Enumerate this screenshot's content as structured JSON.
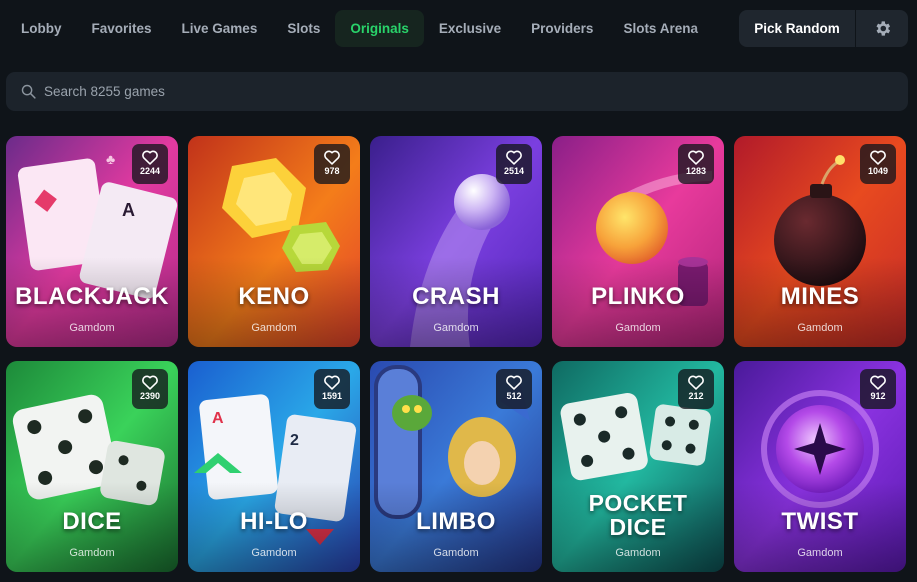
{
  "nav": {
    "tabs": [
      {
        "label": "Lobby",
        "active": false
      },
      {
        "label": "Favorites",
        "active": false
      },
      {
        "label": "Live Games",
        "active": false
      },
      {
        "label": "Slots",
        "active": false
      },
      {
        "label": "Originals",
        "active": true
      },
      {
        "label": "Exclusive",
        "active": false
      },
      {
        "label": "Providers",
        "active": false
      },
      {
        "label": "Slots Arena",
        "active": false
      }
    ],
    "pick_random_label": "Pick Random",
    "settings_icon": "gear-icon"
  },
  "search": {
    "placeholder": "Search 8255 games",
    "value": "",
    "icon": "search-icon"
  },
  "games": [
    {
      "title": "BLACKJACK",
      "provider": "Gamdom",
      "favorites": "2244",
      "theme": "pink-cards"
    },
    {
      "title": "KENO",
      "provider": "Gamdom",
      "favorites": "978",
      "theme": "orange-gems"
    },
    {
      "title": "CRASH",
      "provider": "Gamdom",
      "favorites": "2514",
      "theme": "purple-orb"
    },
    {
      "title": "PLINKO",
      "provider": "Gamdom",
      "favorites": "1283",
      "theme": "magenta-ball"
    },
    {
      "title": "MINES",
      "provider": "Gamdom",
      "favorites": "1049",
      "theme": "red-bomb"
    },
    {
      "title": "DICE",
      "provider": "Gamdom",
      "favorites": "2390",
      "theme": "green-dice"
    },
    {
      "title": "HI-LO",
      "provider": "Gamdom",
      "favorites": "1591",
      "theme": "blue-cards"
    },
    {
      "title": "LIMBO",
      "provider": "Gamdom",
      "favorites": "512",
      "theme": "blue-fantasy"
    },
    {
      "title": "POCKET DICE",
      "provider": "Gamdom",
      "favorites": "212",
      "theme": "teal-dice"
    },
    {
      "title": "TWIST",
      "provider": "Gamdom",
      "favorites": "912",
      "theme": "violet-orb"
    }
  ],
  "colors": {
    "background": "#0f1419",
    "active_tab_text": "#29d36a",
    "active_tab_bg": "#16251f",
    "button_bg": "#1f262e",
    "search_bg": "#1c232b"
  }
}
